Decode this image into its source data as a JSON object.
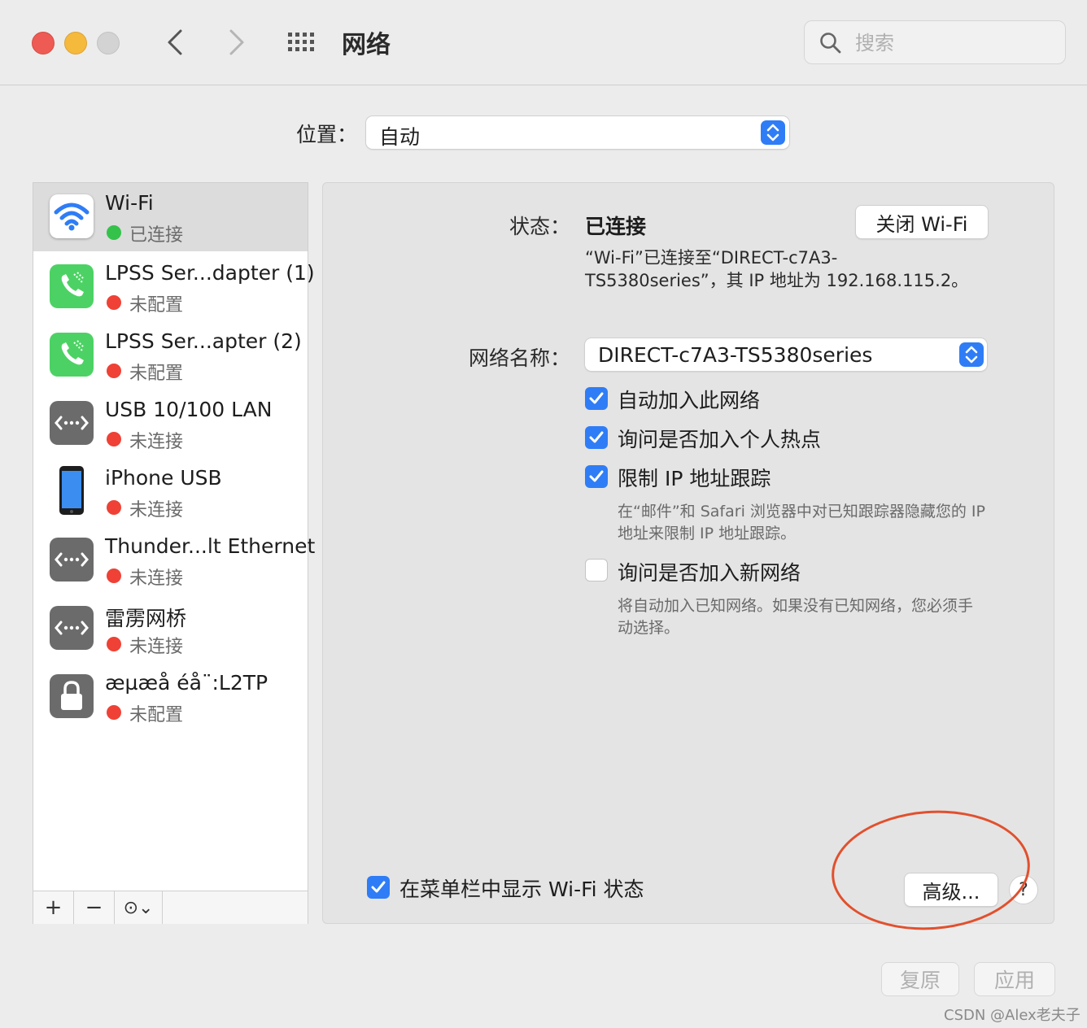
{
  "window": {
    "title": "网络",
    "search_placeholder": "搜索"
  },
  "location": {
    "label": "位置：",
    "value": "自动"
  },
  "services": [
    {
      "name": "Wi-Fi",
      "status": "已连接",
      "status_color": "#34c24a",
      "icon": "wifi-icon",
      "selected": true
    },
    {
      "name": "LPSS Ser...dapter (1)",
      "status": "未配置",
      "status_color": "#ef4135",
      "icon": "phone-icon"
    },
    {
      "name": "LPSS Ser...apter (2)",
      "status": "未配置",
      "status_color": "#ef4135",
      "icon": "phone-icon"
    },
    {
      "name": "USB 10/100 LAN",
      "status": "未连接",
      "status_color": "#ef4135",
      "icon": "ethernet-icon"
    },
    {
      "name": "iPhone USB",
      "status": "未连接",
      "status_color": "#ef4135",
      "icon": "iphone-icon"
    },
    {
      "name": "Thunder...lt Ethernet",
      "status": "未连接",
      "status_color": "#ef4135",
      "icon": "ethernet-icon"
    },
    {
      "name": "雷雳网桥",
      "status": "未连接",
      "status_color": "#ef4135",
      "icon": "ethernet-icon"
    },
    {
      "name": "æµæå éå¨:L2TP",
      "status": "未配置",
      "status_color": "#ef4135",
      "icon": "lock-icon"
    }
  ],
  "sidebar_tools": {
    "add": "+",
    "remove": "−",
    "more": "⊙⌄"
  },
  "detail": {
    "status_label": "状态：",
    "status_value": "已连接",
    "turn_off_button": "关闭 Wi-Fi",
    "status_desc_line1": "“Wi-Fi”已连接至“DIRECT-c7A3-",
    "status_desc_line2": "TS5380series”，其 IP 地址为 192.168.115.2。",
    "network_name_label": "网络名称：",
    "network_name_value": "DIRECT-c7A3-TS5380series",
    "options": [
      {
        "label": "自动加入此网络",
        "checked": true
      },
      {
        "label": "询问是否加入个人热点",
        "checked": true
      },
      {
        "label": "限制 IP 地址跟踪",
        "checked": true
      },
      {
        "label": "询问是否加入新网络",
        "checked": false
      }
    ],
    "limit_ip_note_line1": "在“邮件”和 Safari 浏览器中对已知跟踪器隐藏您的 IP",
    "limit_ip_note_line2": "地址来限制 IP 地址跟踪。",
    "ask_new_note_line1": "将自动加入已知网络。如果没有已知网络，您必须手",
    "ask_new_note_line2": "动选择。",
    "show_in_menu_bar": {
      "label": "在菜单栏中显示 Wi-Fi 状态",
      "checked": true
    },
    "advanced_button": "高级...",
    "help_button": "?"
  },
  "footer": {
    "revert_button": "复原",
    "apply_button": "应用"
  },
  "watermark": "CSDN @Alex老夫子",
  "colors": {
    "accent": "#2f7df6",
    "annotation_ring": "#e1502e",
    "connected": "#34c24a",
    "error": "#ef4135"
  }
}
